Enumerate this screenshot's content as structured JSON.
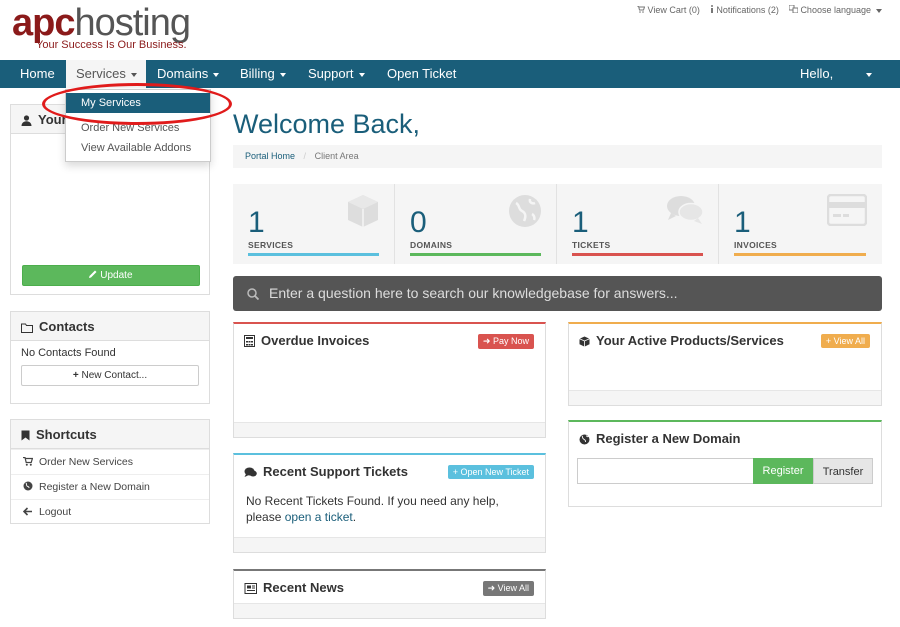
{
  "header": {
    "logo_brand_apc": "apc",
    "logo_brand_hosting": "hosting",
    "logo_slogan": "Your Success Is Our Business.",
    "view_cart": "View Cart (0)",
    "notifications": "Notifications (2)",
    "choose_language": "Choose language"
  },
  "nav": {
    "home": "Home",
    "services": "Services",
    "domains": "Domains",
    "billing": "Billing",
    "support": "Support",
    "open_ticket": "Open Ticket",
    "hello": "Hello,"
  },
  "services_menu": {
    "items": [
      "My Services",
      "Order New Services",
      "View Available Addons"
    ]
  },
  "sidebar": {
    "your_info_title": "Your",
    "update_label": "Update",
    "contacts_title": "Contacts",
    "contacts_empty": "No Contacts Found",
    "new_contact_label": "New Contact...",
    "shortcuts_title": "Shortcuts",
    "shortcuts": [
      "Order New Services",
      "Register a New Domain",
      "Logout"
    ]
  },
  "main": {
    "welcome": "Welcome Back,",
    "breadcrumb_home": "Portal Home",
    "breadcrumb_sep": "/",
    "breadcrumb_current": "Client Area",
    "stats": [
      {
        "count": "1",
        "label": "SERVICES",
        "color": "#5bc0de"
      },
      {
        "count": "0",
        "label": "DOMAINS",
        "color": "#5cb85c"
      },
      {
        "count": "1",
        "label": "TICKETS",
        "color": "#d9534f"
      },
      {
        "count": "1",
        "label": "INVOICES",
        "color": "#f0ad4e"
      }
    ],
    "kb_search_placeholder": "Enter a question here to search our knowledgebase for answers...",
    "overdue_title": "Overdue Invoices",
    "pay_now": "Pay Now",
    "tickets_title": "Recent Support Tickets",
    "open_new_ticket": "Open New Ticket",
    "tickets_empty": "No Recent Tickets Found. If you need any help, please",
    "tickets_link": "open a ticket",
    "tickets_end": ".",
    "news_title": "Recent News",
    "view_all": "View All",
    "products_title": "Your Active Products/Services",
    "register_title": "Register a New Domain",
    "register_btn": "Register",
    "transfer_btn": "Transfer"
  },
  "colors": {
    "nav_bg": "#1a5e7a",
    "brand_red": "#8b1a1a",
    "annotation": "#e01b1b"
  }
}
